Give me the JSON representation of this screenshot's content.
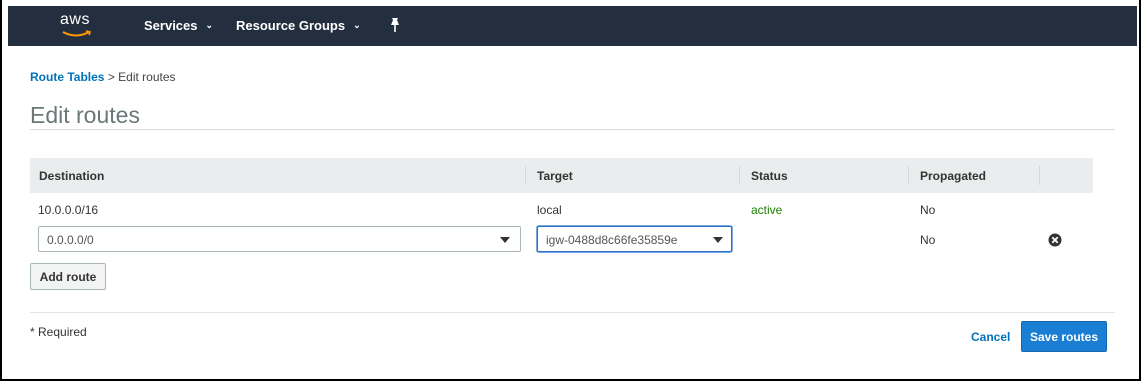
{
  "header": {
    "logo_text": "aws",
    "nav": [
      {
        "label": "Services"
      },
      {
        "label": "Resource Groups"
      }
    ],
    "colors": {
      "topbar": "#232f3e",
      "smile": "#ff9900"
    }
  },
  "breadcrumb": {
    "parent": "Route Tables",
    "separator": ">",
    "current": "Edit routes"
  },
  "page_title": "Edit routes",
  "routes_table": {
    "columns": [
      "Destination",
      "Target",
      "Status",
      "Propagated"
    ],
    "rows": [
      {
        "destination": "10.0.0.0/16",
        "target": "local",
        "status": "active",
        "propagated": "No"
      },
      {
        "destination": "0.0.0.0/0",
        "target": "igw-0488d8c66fe35859e",
        "status": "",
        "propagated": "No"
      }
    ]
  },
  "actions": {
    "add_route": "Add route",
    "required_note": "* Required",
    "cancel": "Cancel",
    "save": "Save routes"
  },
  "icons": {
    "pin": "pin-icon",
    "remove": "remove-circle-icon",
    "dropdown": "chevron-down-icon"
  },
  "colors": {
    "link": "#0073bb",
    "status_active": "#1d8102",
    "primary_button": "#1a7fd4"
  }
}
